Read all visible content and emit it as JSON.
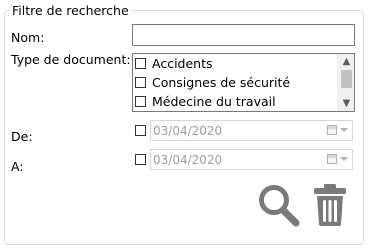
{
  "group": {
    "title": "Filtre de recherche"
  },
  "fields": {
    "nom_label": "Nom:",
    "nom_value": "",
    "type_label": "Type de document:",
    "de_label": "De:",
    "a_label": "A:"
  },
  "document_types": [
    {
      "label": "Accidents",
      "checked": false
    },
    {
      "label": "Consignes de sécurité",
      "checked": false
    },
    {
      "label": "Médecine du travail",
      "checked": false
    }
  ],
  "dates": {
    "de": {
      "enabled": false,
      "value": "03/04/2020"
    },
    "a": {
      "enabled": false,
      "value": "03/04/2020"
    }
  },
  "icons": {
    "search": "magnifier-icon",
    "delete": "trash-icon",
    "calendar": "calendar-icon",
    "dropdown": "chevron-down-icon"
  },
  "colors": {
    "icon_gray": "#7a7a7a",
    "disabled_text": "#a0a0a0"
  }
}
